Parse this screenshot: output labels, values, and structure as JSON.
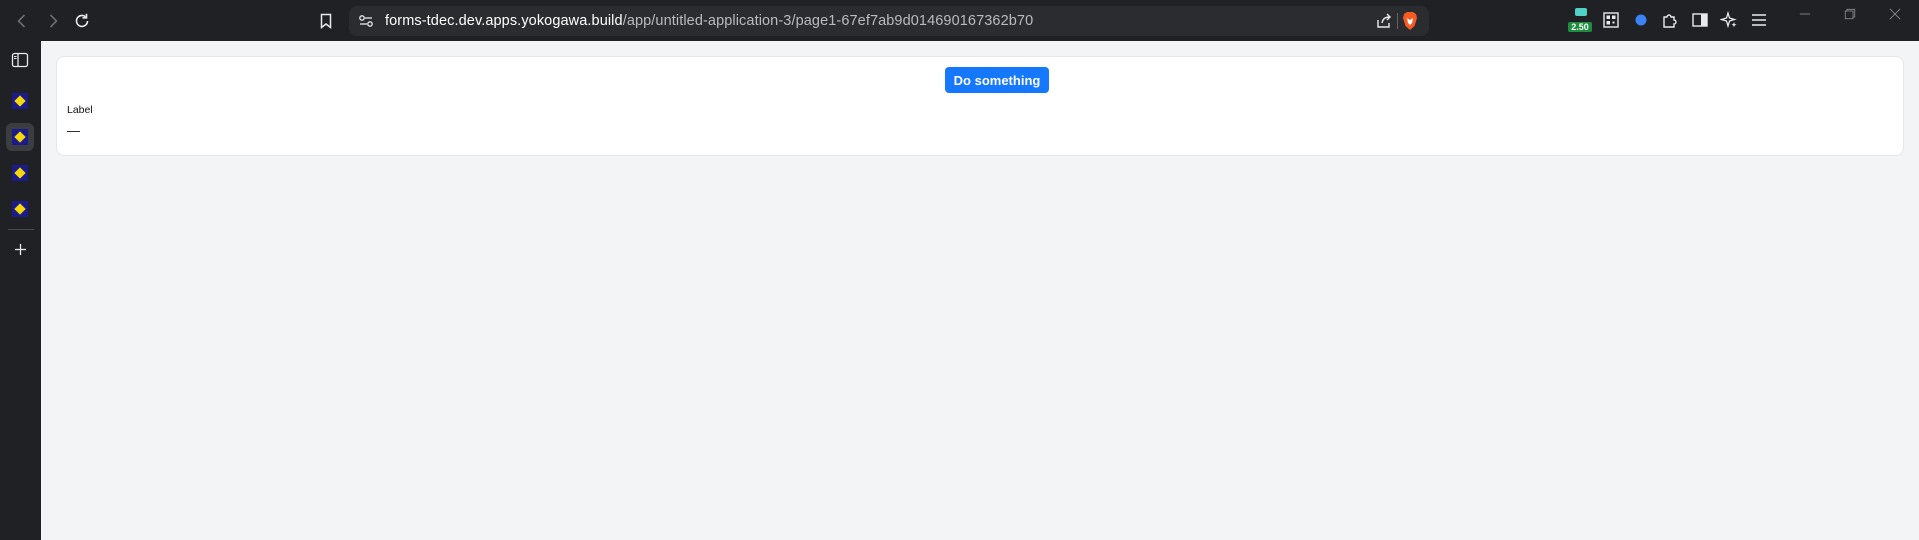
{
  "browser": {
    "url_host": "forms-tdec.dev.apps.yokogawa.build",
    "url_path": "/app/untitled-application-3/page1-67ef7ab9d014690167362b70",
    "extension_badge": "2.50"
  },
  "sidebar": {
    "tabs": [
      {
        "icon": "app-favicon",
        "active": false
      },
      {
        "icon": "app-favicon",
        "active": true
      },
      {
        "icon": "app-favicon",
        "active": false
      },
      {
        "icon": "app-favicon",
        "active": false
      }
    ]
  },
  "page": {
    "action_button_label": "Do something",
    "field_label": "Label",
    "field_value": "—"
  },
  "colors": {
    "accent": "#1677ff",
    "page_background": "#f3f4f6",
    "browser_chrome": "#202124"
  }
}
